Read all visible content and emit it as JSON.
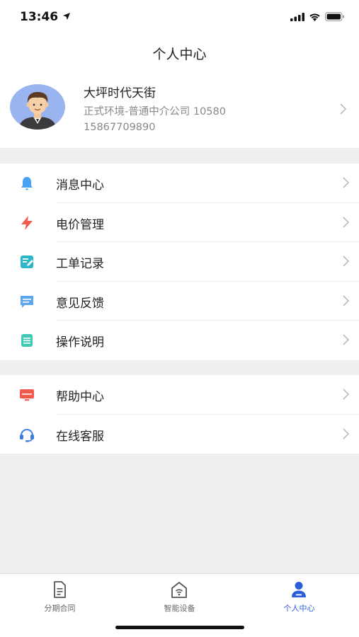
{
  "status": {
    "time": "13:46"
  },
  "nav": {
    "title": "个人中心"
  },
  "profile": {
    "name": "大坪时代天街",
    "company": "正式环境-普通中介公司 10580",
    "phone": "15867709890"
  },
  "menu_group_1": [
    {
      "label": "消息中心",
      "icon": "bell-icon",
      "color": "#4aa3f2"
    },
    {
      "label": "电价管理",
      "icon": "lightning-icon",
      "color": "#f0594c"
    },
    {
      "label": "工单记录",
      "icon": "edit-note-icon",
      "color": "#2bb7c9"
    },
    {
      "label": "意见反馈",
      "icon": "chat-bubble-icon",
      "color": "#5aa7f0"
    },
    {
      "label": "操作说明",
      "icon": "document-icon",
      "color": "#3fc9b4"
    }
  ],
  "menu_group_2": [
    {
      "label": "帮助中心",
      "icon": "monitor-icon",
      "color": "#f0594c"
    },
    {
      "label": "在线客服",
      "icon": "headset-icon",
      "color": "#3b7de0"
    }
  ],
  "tabbar": {
    "tabs": [
      {
        "label": "分期合同",
        "icon": "contract-icon",
        "active": false
      },
      {
        "label": "智能设备",
        "icon": "smart-home-icon",
        "active": false
      },
      {
        "label": "个人中心",
        "icon": "user-icon",
        "active": true
      }
    ],
    "active_color": "#2b5fd9"
  }
}
